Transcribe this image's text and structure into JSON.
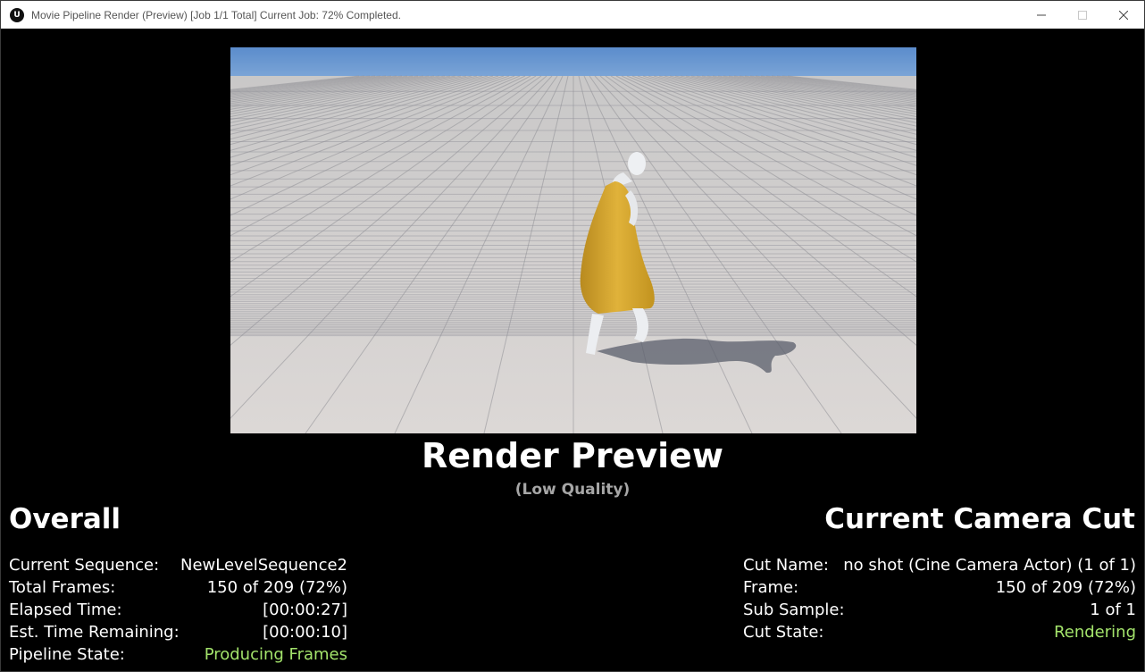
{
  "window": {
    "title": "Movie Pipeline Render (Preview) [Job 1/1 Total] Current Job: 72% Completed.",
    "app_icon": "unreal-logo-icon",
    "app_icon_glyph": "U"
  },
  "preview": {
    "title": "Render Preview",
    "subtitle": "(Low Quality)"
  },
  "overall": {
    "heading": "Overall",
    "rows": [
      {
        "label": "Current Sequence:",
        "value": "NewLevelSequence2"
      },
      {
        "label": "Total Frames:",
        "value": "150 of 209 (72%)"
      },
      {
        "label": "Elapsed Time:",
        "value": "[00:00:27]"
      },
      {
        "label": "Est. Time Remaining:",
        "value": "[00:00:10]"
      },
      {
        "label": "Pipeline State:",
        "value": "Producing Frames"
      }
    ]
  },
  "camera_cut": {
    "heading": "Current Camera Cut",
    "rows": [
      {
        "label": "Cut Name:",
        "value": "no shot (Cine Camera Actor) (1 of 1)"
      },
      {
        "label": "Frame:",
        "value": "150 of 209 (72%)"
      },
      {
        "label": "Sub Sample:",
        "value": "1 of 1"
      },
      {
        "label": "Cut State:",
        "value": "Rendering"
      }
    ]
  },
  "colors": {
    "state_green": "#a3e36b",
    "sky": "#6e9cd0",
    "floor": "#d6d3d1",
    "dress": "#d4a42a"
  }
}
